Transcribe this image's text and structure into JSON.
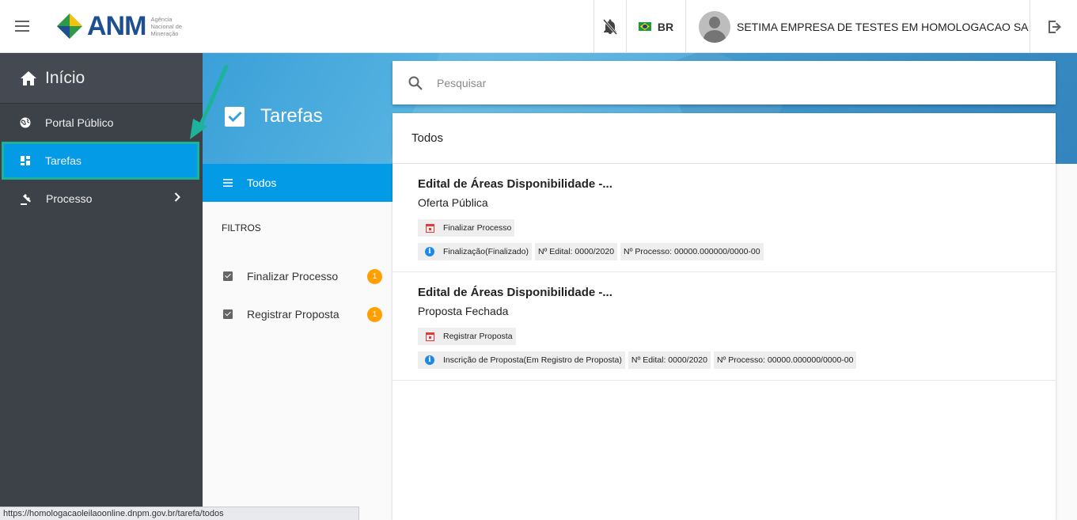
{
  "header": {
    "logo_text": "ANM",
    "logo_sub": "Agência Nacional de Mineração",
    "language": "BR",
    "user_name": "SETIMA EMPRESA DE TESTES EM HOMOLOGACAO SA"
  },
  "sidebar": {
    "home_label": "Início",
    "items": [
      {
        "label": "Portal Público",
        "icon": "globe-icon"
      },
      {
        "label": "Tarefas",
        "icon": "dashboard-icon"
      },
      {
        "label": "Processo",
        "icon": "gavel-icon"
      }
    ]
  },
  "page": {
    "title": "Tarefas"
  },
  "filters": {
    "todos_label": "Todos",
    "heading": "FILTROS",
    "items": [
      {
        "label": "Finalizar Processo",
        "count": "1"
      },
      {
        "label": "Registrar Proposta",
        "count": "1"
      }
    ]
  },
  "search": {
    "placeholder": "Pesquisar"
  },
  "content": {
    "heading": "Todos",
    "tasks": [
      {
        "title": "Edital de Áreas Disponibilidade -...",
        "subtitle": "Oferta Pública",
        "action": "Finalizar Processo",
        "status": "Finalização(Finalizado)",
        "edital": "Nº Edital: 0000/2020",
        "processo": "Nº Processo: 00000.000000/0000-00"
      },
      {
        "title": "Edital de Áreas Disponibilidade -...",
        "subtitle": "Proposta Fechada",
        "action": "Registrar Proposta",
        "status": "Inscrição de Proposta(Em Registro de Proposta)",
        "edital": "Nº Edital: 0000/2020",
        "processo": "Nº Processo: 00000.000000/0000-00"
      }
    ]
  },
  "statusbar": {
    "url": "https://homologacaoleilaoonline.dnpm.gov.br/tarefa/todos"
  },
  "colors": {
    "accent": "#039be5",
    "sidebar_bg": "#3d4249",
    "highlight": "#1db39a",
    "badge": "#ffa000"
  }
}
